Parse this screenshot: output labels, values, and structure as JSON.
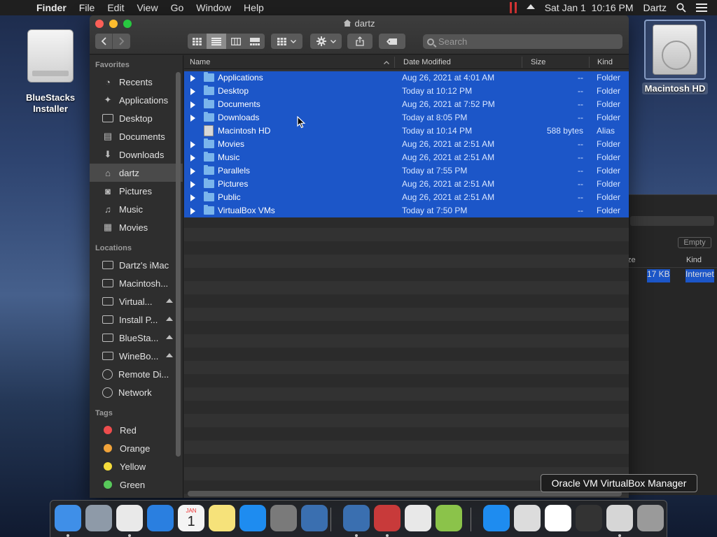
{
  "menubar": {
    "app": "Finder",
    "menus": [
      "File",
      "Edit",
      "View",
      "Go",
      "Window",
      "Help"
    ],
    "datetime": "Sat Jan 1  10:16 PM",
    "user": "Dartz"
  },
  "desktop": {
    "left_icon": "BlueStacks Installer",
    "right_icon": "Macintosh HD"
  },
  "finder": {
    "title": "dartz",
    "search_placeholder": "Search",
    "sidebar": {
      "favorites_header": "Favorites",
      "favorites": [
        {
          "label": "Recents",
          "icon": "clock-icon"
        },
        {
          "label": "Applications",
          "icon": "applications-icon"
        },
        {
          "label": "Desktop",
          "icon": "desktop-icon"
        },
        {
          "label": "Documents",
          "icon": "documents-icon"
        },
        {
          "label": "Downloads",
          "icon": "downloads-icon"
        },
        {
          "label": "dartz",
          "icon": "home-icon"
        },
        {
          "label": "Pictures",
          "icon": "camera-icon"
        },
        {
          "label": "Music",
          "icon": "music-icon"
        },
        {
          "label": "Movies",
          "icon": "film-icon"
        }
      ],
      "locations_header": "Locations",
      "locations": [
        {
          "label": "Dartz's iMac",
          "eject": false
        },
        {
          "label": "Macintosh...",
          "eject": false
        },
        {
          "label": "Virtual...",
          "eject": true
        },
        {
          "label": "Install P...",
          "eject": true
        },
        {
          "label": "BlueSta...",
          "eject": true
        },
        {
          "label": "WineBo...",
          "eject": true
        },
        {
          "label": "Remote Di...",
          "eject": false
        },
        {
          "label": "Network",
          "eject": false
        }
      ],
      "tags_header": "Tags",
      "tags": [
        {
          "label": "Red",
          "color": "#ee4d4d"
        },
        {
          "label": "Orange",
          "color": "#f1a33a"
        },
        {
          "label": "Yellow",
          "color": "#f5dc3b"
        },
        {
          "label": "Green",
          "color": "#58c95a"
        }
      ]
    },
    "columns": {
      "name": "Name",
      "date": "Date Modified",
      "size": "Size",
      "kind": "Kind"
    },
    "rows": [
      {
        "name": "Applications",
        "date": "Aug 26, 2021 at 4:01 AM",
        "size": "--",
        "kind": "Folder",
        "type": "folder"
      },
      {
        "name": "Desktop",
        "date": "Today at 10:12 PM",
        "size": "--",
        "kind": "Folder",
        "type": "folder"
      },
      {
        "name": "Documents",
        "date": "Aug 26, 2021 at 7:52 PM",
        "size": "--",
        "kind": "Folder",
        "type": "folder"
      },
      {
        "name": "Downloads",
        "date": "Today at 8:05 PM",
        "size": "--",
        "kind": "Folder",
        "type": "folder"
      },
      {
        "name": "Macintosh HD",
        "date": "Today at 10:14 PM",
        "size": "588 bytes",
        "kind": "Alias",
        "type": "alias"
      },
      {
        "name": "Movies",
        "date": "Aug 26, 2021 at 2:51 AM",
        "size": "--",
        "kind": "Folder",
        "type": "folder"
      },
      {
        "name": "Music",
        "date": "Aug 26, 2021 at 2:51 AM",
        "size": "--",
        "kind": "Folder",
        "type": "folder"
      },
      {
        "name": "Parallels",
        "date": "Today at 7:55 PM",
        "size": "--",
        "kind": "Folder",
        "type": "folder"
      },
      {
        "name": "Pictures",
        "date": "Aug 26, 2021 at 2:51 AM",
        "size": "--",
        "kind": "Folder",
        "type": "folder"
      },
      {
        "name": "Public",
        "date": "Aug 26, 2021 at 2:51 AM",
        "size": "--",
        "kind": "Folder",
        "type": "folder"
      },
      {
        "name": "VirtualBox VMs",
        "date": "Today at 7:50 PM",
        "size": "--",
        "kind": "Folder",
        "type": "folder"
      }
    ]
  },
  "background_window": {
    "empty_button": "Empty",
    "col_size_partial": "ze",
    "col_kind": "Kind",
    "row_size": "17 KB",
    "row_kind": "Internet"
  },
  "tooltip": "Oracle VM VirtualBox Manager",
  "calendar_icon": {
    "month": "JAN",
    "day": "1"
  },
  "dock": [
    {
      "name": "finder-icon",
      "color": "#3f8fe8"
    },
    {
      "name": "launchpad-icon",
      "color": "#8e9aa8"
    },
    {
      "name": "chrome-icon",
      "color": "#e9e9e9"
    },
    {
      "name": "safari-icon",
      "color": "#2a7fe0"
    },
    {
      "name": "calendar-icon",
      "color": "#f4f4f4"
    },
    {
      "name": "notes-icon",
      "color": "#f6e27a"
    },
    {
      "name": "app-store-icon",
      "color": "#1e8cf0"
    },
    {
      "name": "system-preferences-icon",
      "color": "#7a7a7a"
    },
    {
      "name": "virtualbox-icon",
      "color": "#3a6fb0"
    },
    {
      "name": "virtualbox-vm-icon",
      "color": "#3a6fb0"
    },
    {
      "name": "parallels-icon",
      "color": "#c83a3a"
    },
    {
      "name": "textedit-icon",
      "color": "#e8e8e8"
    },
    {
      "name": "android-icon",
      "color": "#8bc34a"
    },
    {
      "name": "app-store-2-icon",
      "color": "#1e8cf0"
    },
    {
      "name": "document-icon",
      "color": "#dcdcdc"
    },
    {
      "name": "chrome-window-icon",
      "color": "#ffffff"
    },
    {
      "name": "terminal-icon",
      "color": "#333333"
    },
    {
      "name": "screenshot-icon",
      "color": "#d6d6d6"
    },
    {
      "name": "trash-icon",
      "color": "#9a9a9a"
    }
  ]
}
